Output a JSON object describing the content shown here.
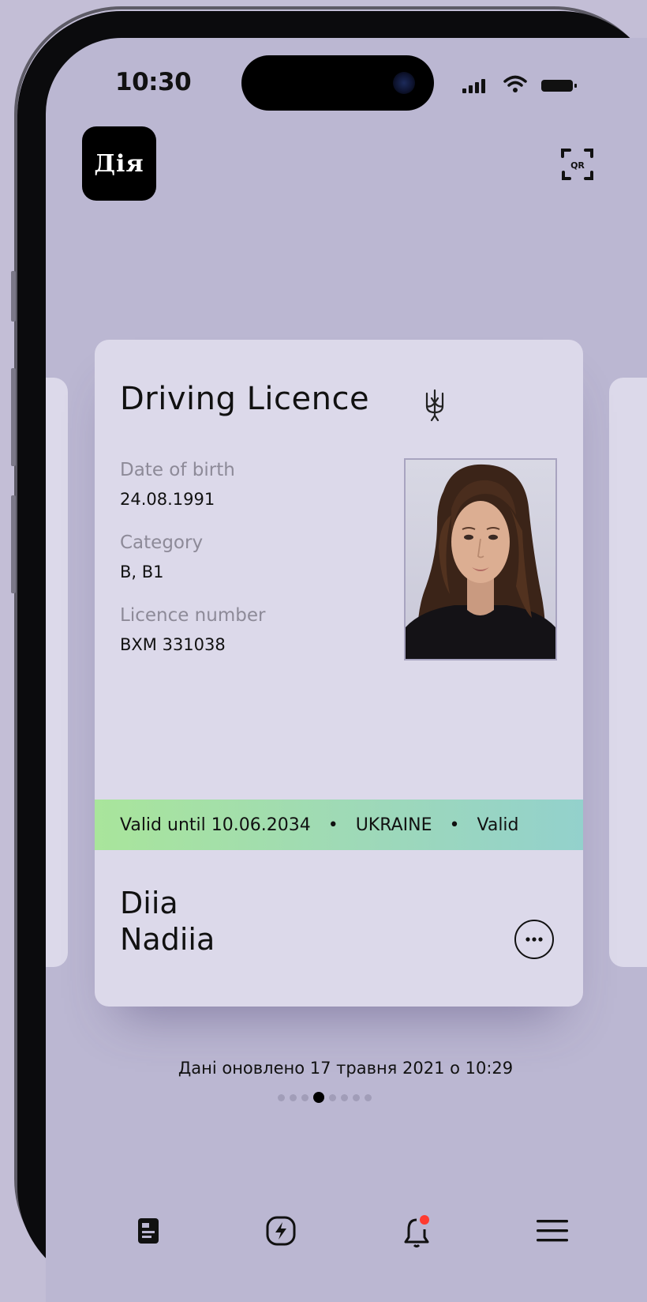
{
  "status_bar": {
    "time": "10:30"
  },
  "header": {
    "logo_text": "Дія",
    "qr_label": "QR"
  },
  "card": {
    "title": "Driving Licence",
    "fields": [
      {
        "label": "Date of birth",
        "value": "24.08.1991"
      },
      {
        "label": "Category",
        "value": "B, B1"
      },
      {
        "label": "Licence number",
        "value": "BXM 331038"
      }
    ],
    "ribbon": {
      "valid_text": "Valid until 10.06.2034",
      "country": "UKRAINE",
      "valid_text_short": "Valid"
    },
    "holder": {
      "last_name": "Diia",
      "first_name": "Nadiia"
    }
  },
  "updated_text": "Дані оновлено 17 травня 2021 о 10:29",
  "pager": {
    "count": 8,
    "active_index": 3
  },
  "tabs": [
    {
      "icon": "document-icon"
    },
    {
      "icon": "services-lightning-icon"
    },
    {
      "icon": "notifications-bell-icon",
      "badge_color": "#ff3b30"
    },
    {
      "icon": "menu-icon"
    }
  ],
  "colors": {
    "background": "#bbb7d2",
    "card": "#dcd9ea",
    "ribbon_start": "#a9e59b",
    "ribbon_end": "#93d1cc"
  }
}
